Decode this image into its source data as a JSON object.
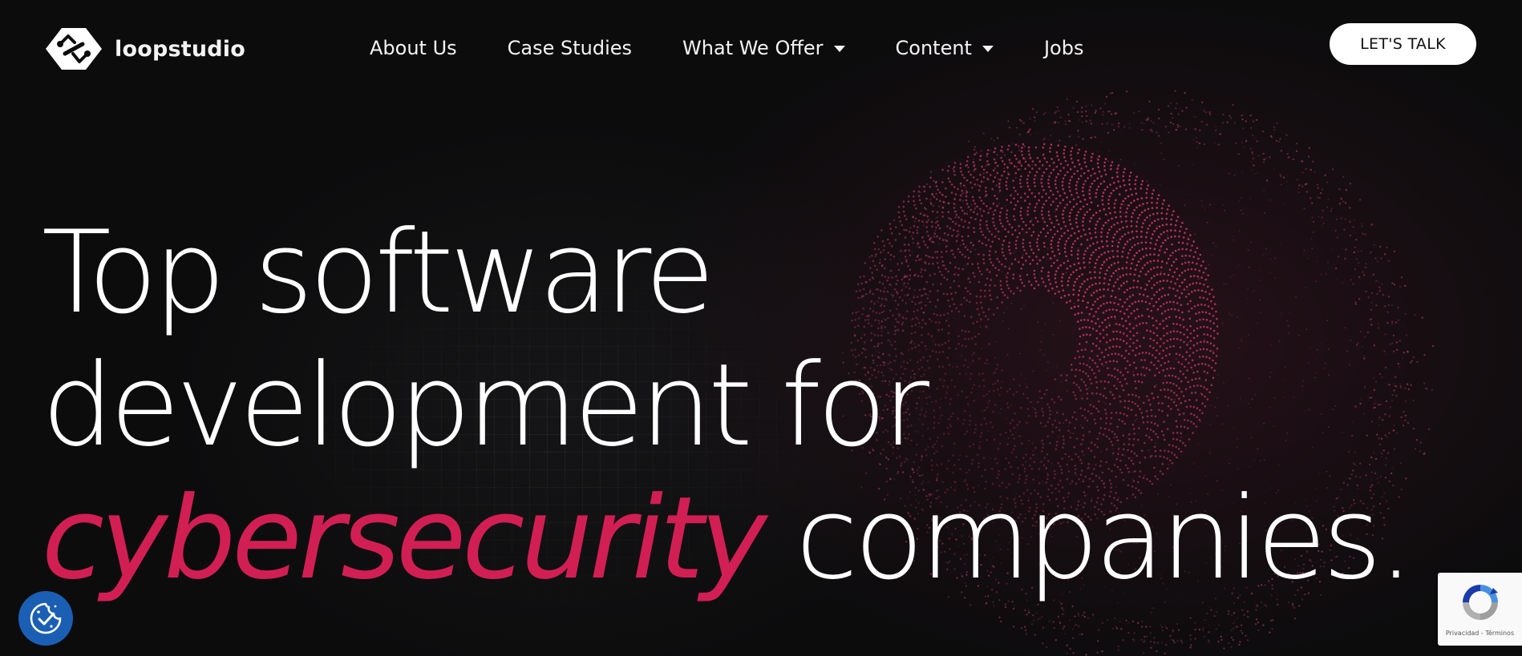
{
  "brand": {
    "name": "loopstudio"
  },
  "nav": {
    "items": [
      {
        "label": "About Us",
        "has_dropdown": false
      },
      {
        "label": "Case Studies",
        "has_dropdown": false
      },
      {
        "label": "What We Offer",
        "has_dropdown": true
      },
      {
        "label": "Content",
        "has_dropdown": true
      },
      {
        "label": "Jobs",
        "has_dropdown": false
      }
    ]
  },
  "cta": {
    "label": "LET'S TALK"
  },
  "hero": {
    "line1": "Top software",
    "line2": "development for",
    "accent": "cybersecurity",
    "line3_rest": " companies."
  },
  "recaptcha": {
    "text": "Privacidad - Términos"
  },
  "icons": {
    "logo": "loopstudio-logo-icon",
    "cookie": "cookie-consent-icon",
    "recaptcha": "recaptcha-logo-icon",
    "dropdown": "caret-down-icon"
  },
  "colors": {
    "background": "#0c0c0d",
    "accent": "#d11f54",
    "text": "#ffffff",
    "cookie_badge": "#1b5fb4"
  }
}
